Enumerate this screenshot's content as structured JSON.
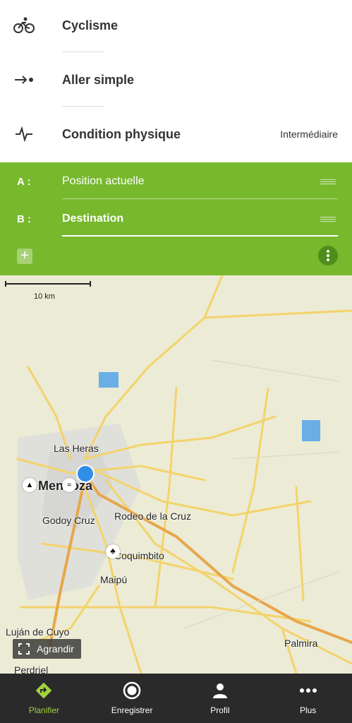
{
  "settings": {
    "activity": {
      "label": "Cyclisme",
      "icon": "bicycle-icon"
    },
    "route_type": {
      "label": "Aller simple",
      "icon": "one-way-arrow-icon"
    },
    "fitness": {
      "label": "Condition physique",
      "value": "Intermédiaire",
      "icon": "pulse-icon"
    }
  },
  "route": {
    "a_key": "A :",
    "a_value": "Position actuelle",
    "b_key": "B :",
    "b_value": "Destination"
  },
  "map": {
    "scale_label": "10 km",
    "labels": {
      "las_heras": "Las Heras",
      "mendoza": "Mendoza",
      "godoy_cruz": "Godoy Cruz",
      "rodeo": "Rodeo de la Cruz",
      "coquimbito": "Coquimbito",
      "maipu": "Maipú",
      "lujan": "Luján de Cuyo",
      "palmira": "Palmira",
      "perdriel": "Perdriel"
    },
    "expand_label": "Agrandir"
  },
  "nav": {
    "items": [
      {
        "label": "Planifier",
        "icon": "route-plan-icon",
        "active": true
      },
      {
        "label": "Enregistrer",
        "icon": "record-icon",
        "active": false
      },
      {
        "label": "Profil",
        "icon": "profile-icon",
        "active": false
      },
      {
        "label": "Plus",
        "icon": "more-icon",
        "active": false
      }
    ]
  },
  "colors": {
    "accent": "#77b82d",
    "nav_bg": "#2a2a2a",
    "active_nav": "#9fd33a",
    "road": "#f3d36b"
  }
}
